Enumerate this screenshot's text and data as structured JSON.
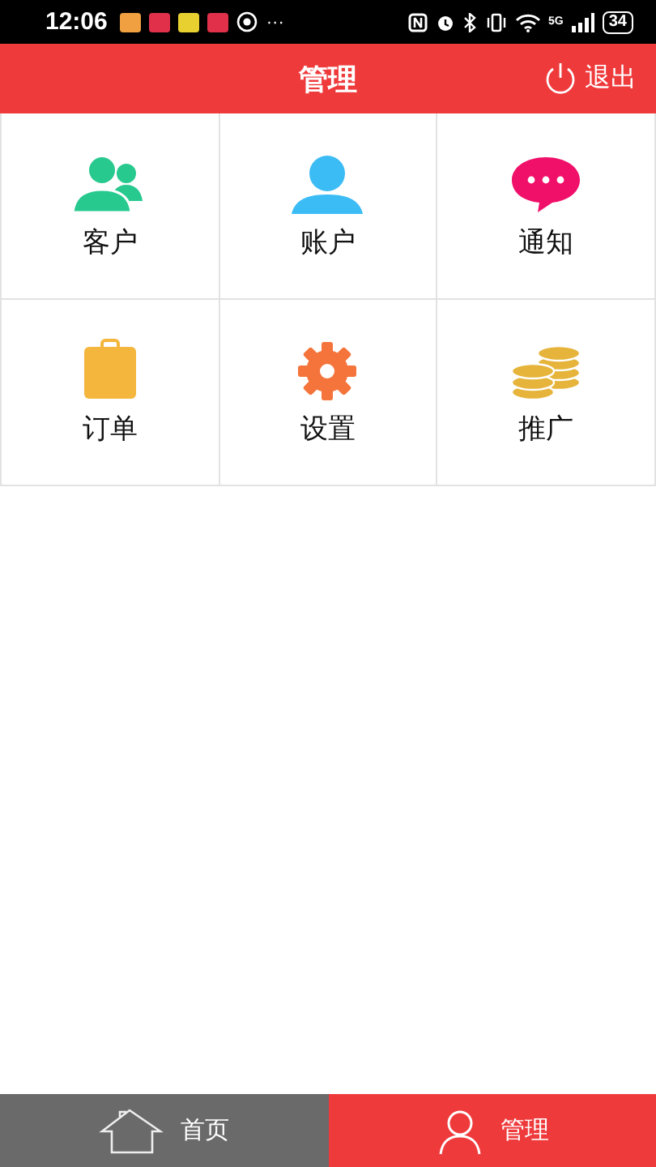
{
  "status_bar": {
    "time": "12:06",
    "more": "···",
    "network": "5G",
    "battery": "34"
  },
  "header": {
    "title": "管理",
    "logout": "退出"
  },
  "grid": [
    {
      "label": "客户",
      "kind": "users"
    },
    {
      "label": "账户",
      "kind": "user"
    },
    {
      "label": "通知",
      "kind": "chat"
    },
    {
      "label": "订单",
      "kind": "clipboard"
    },
    {
      "label": "设置",
      "kind": "gear"
    },
    {
      "label": "推广",
      "kind": "coins"
    }
  ],
  "tabs": [
    {
      "label": "首页",
      "kind": "home",
      "selected": false
    },
    {
      "label": "管理",
      "kind": "person",
      "selected": true
    }
  ]
}
